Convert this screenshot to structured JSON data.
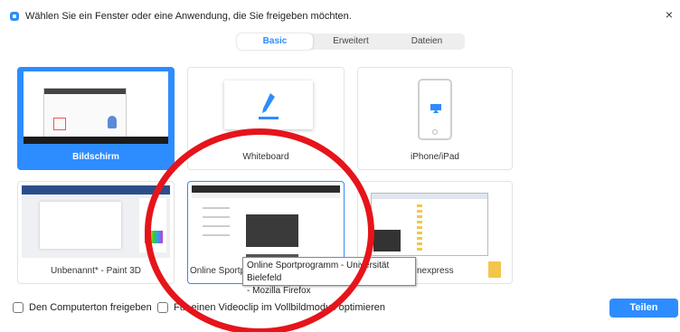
{
  "window": {
    "title": "Wählen Sie ein Fenster oder eine Anwendung, die Sie freigeben möchten.",
    "close_glyph": "×"
  },
  "tabs": [
    {
      "label": "Basic",
      "active": true
    },
    {
      "label": "Erweitert",
      "active": false
    },
    {
      "label": "Dateien",
      "active": false
    }
  ],
  "tiles": {
    "screen": {
      "label": "Bildschirm"
    },
    "whiteboard": {
      "label": "Whiteboard"
    },
    "iphone": {
      "label": "iPhone/iPad"
    },
    "paint": {
      "label": "Unbenannt* - Paint 3D"
    },
    "firefox": {
      "label": "Online Sportprogramm - Universität Bielefeld - Mozilla Firefox"
    },
    "explorer": {
      "label": "nexpress"
    }
  },
  "tooltip": {
    "line1": "Online Sportprogramm - Universität Bielefeld",
    "line2": "- Mozilla Firefox"
  },
  "footer": {
    "sound_label": "Den Computerton freigeben",
    "video_label": "Für einen Videoclip im Vollbildmodus optimieren",
    "share_label": "Teilen"
  },
  "colors": {
    "accent": "#2d8cff",
    "annotation_red": "#e6141b"
  }
}
